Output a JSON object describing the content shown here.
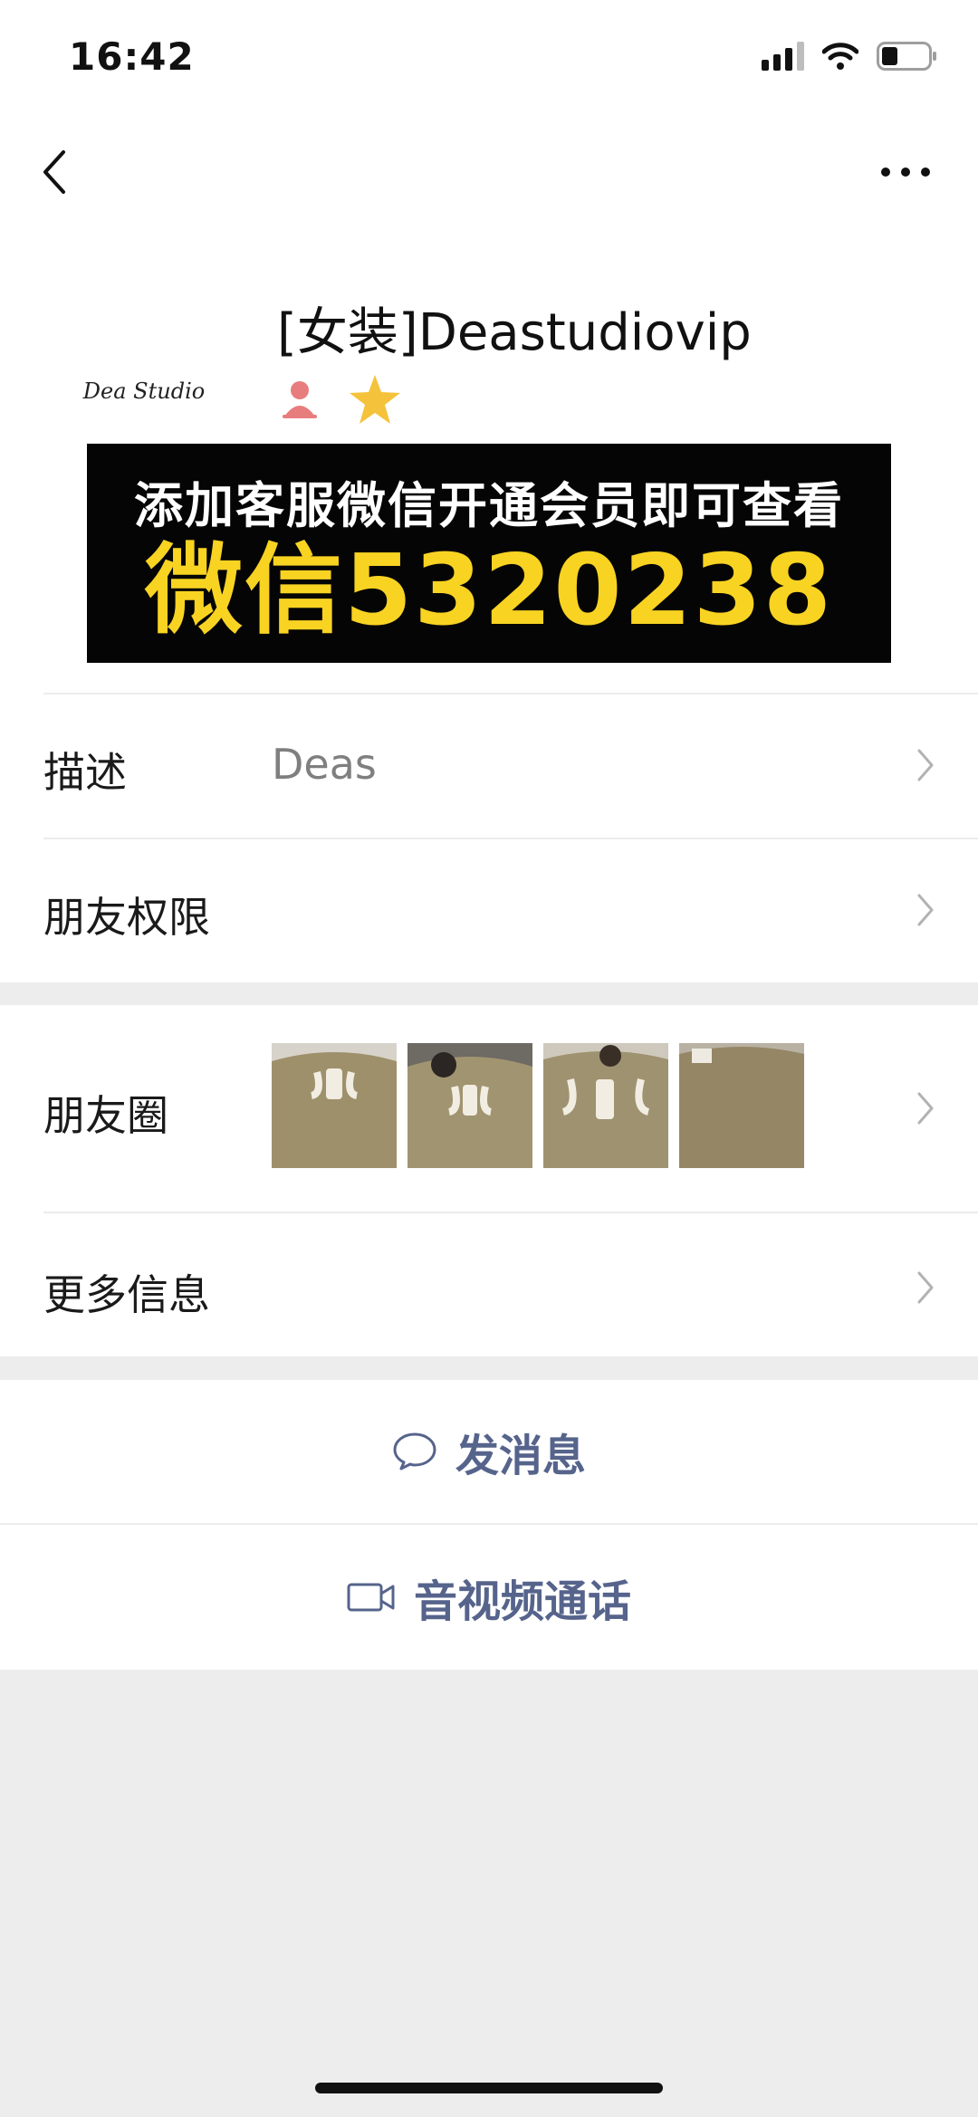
{
  "status_bar": {
    "time": "16:42"
  },
  "profile": {
    "avatar_text": "Dea Studio",
    "name": "[女装]Deastudiovip",
    "badges": [
      "person-icon",
      "star-icon"
    ]
  },
  "banner": {
    "line1": "添加客服微信开通会员即可查看",
    "line2": "微信5320238"
  },
  "rows": {
    "description": {
      "label": "描述",
      "value": "Deas"
    },
    "friend_permissions": {
      "label": "朋友权限"
    },
    "moments": {
      "label": "朋友圈",
      "thumbnail_count": 4
    },
    "more_info": {
      "label": "更多信息"
    }
  },
  "actions": {
    "send_message": "发消息",
    "video_call": "音视频通话"
  },
  "colors": {
    "accent_link": "#56648c",
    "banner_yellow": "#f8d322",
    "page_gray": "#ededed"
  }
}
